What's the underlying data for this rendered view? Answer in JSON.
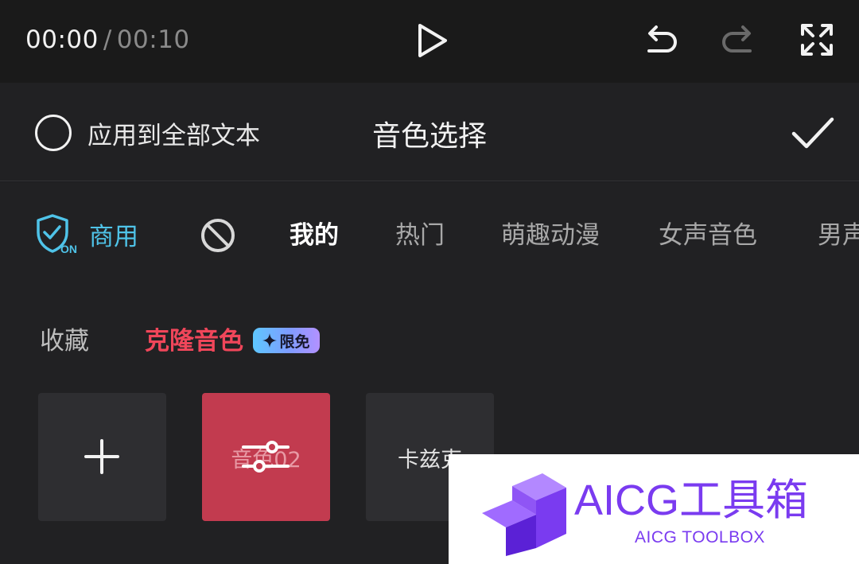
{
  "player": {
    "current_time": "00:00",
    "separator": "/",
    "duration": "00:10"
  },
  "header": {
    "apply_all_label": "应用到全部文本",
    "title": "音色选择"
  },
  "tabs": {
    "commercial_label": "商用",
    "commercial_badge": "ON",
    "items": [
      "我的",
      "热门",
      "萌趣动漫",
      "女声音色",
      "男声"
    ],
    "active_index": 0
  },
  "subtabs": {
    "favorites": "收藏",
    "clone_voice": "克隆音色",
    "free_badge": "限免"
  },
  "tiles": {
    "voice1_label": "音色02",
    "voice2_label": "卡兹克"
  },
  "watermark": {
    "title": "AICG工具箱",
    "subtitle": "AICG TOOLBOX"
  },
  "colors": {
    "background": "#1c1c1e",
    "accent_commercial": "#4fc3e8",
    "accent_clone": "#f0465a",
    "tile_selected": "#c23b4f",
    "watermark": "#7a3bf0"
  },
  "icons": {
    "play": "play-icon",
    "undo": "undo-icon",
    "redo": "redo-icon",
    "fullscreen": "fullscreen-icon",
    "confirm": "checkmark-icon",
    "commercial": "shield-check-icon",
    "none": "ban-icon",
    "add": "plus-icon",
    "adjust": "sliders-icon",
    "free_badge": "sparkle-icon"
  }
}
